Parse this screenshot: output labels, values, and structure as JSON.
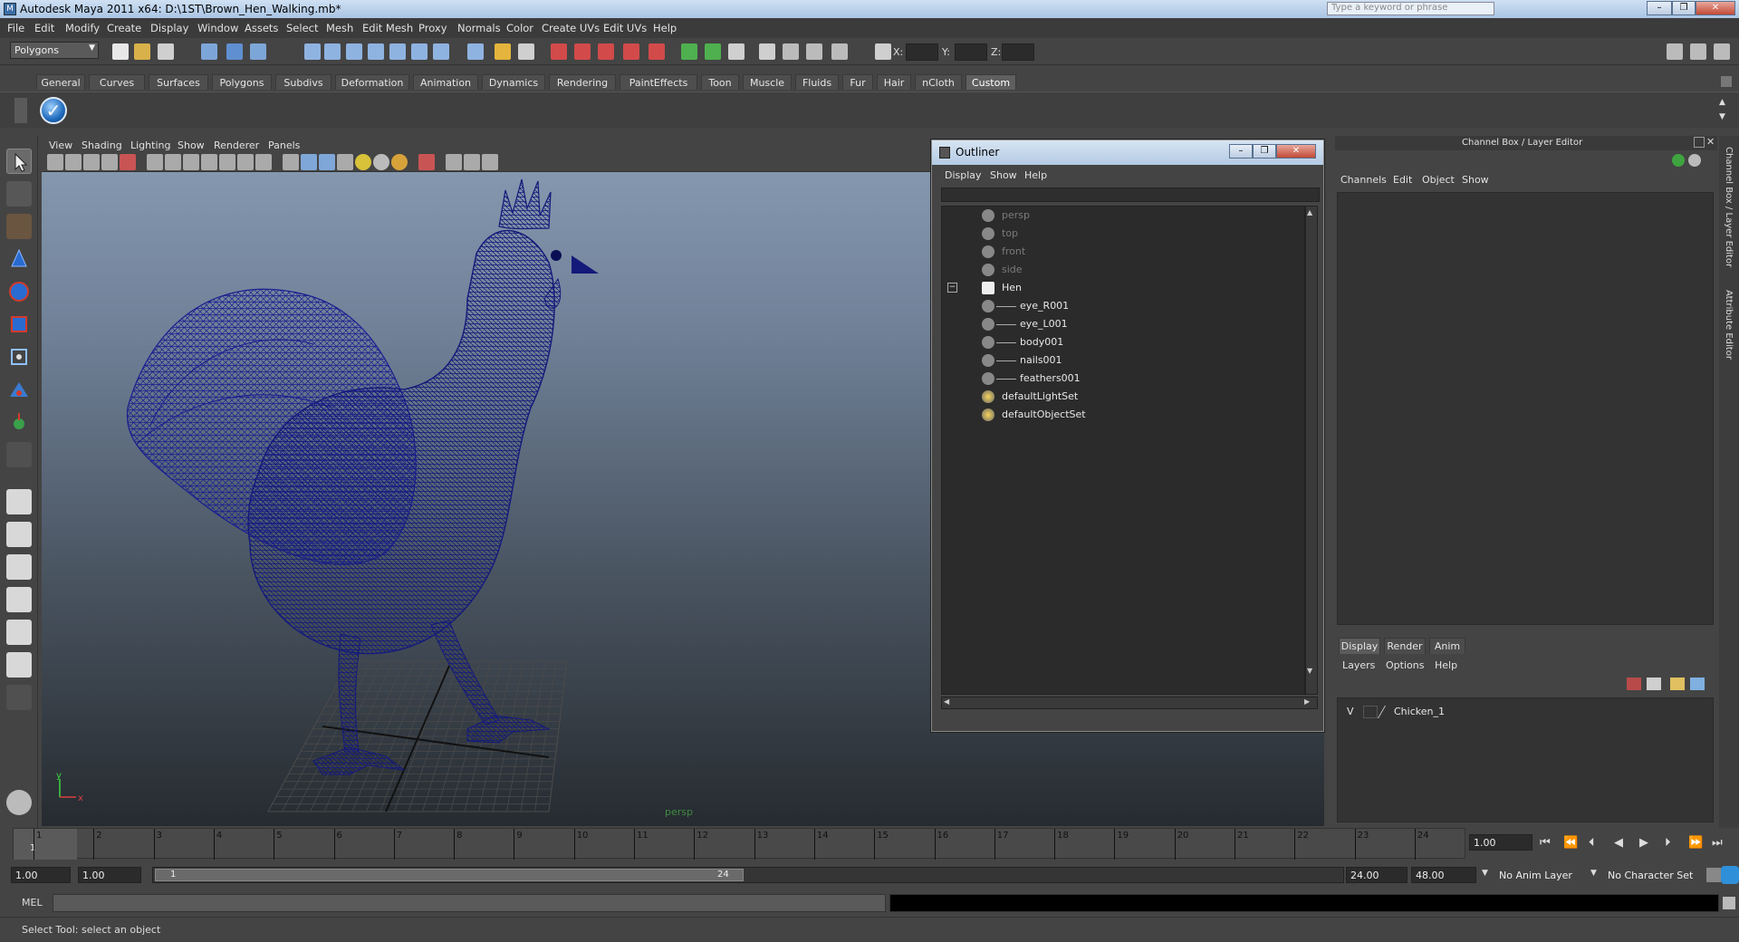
{
  "window": {
    "title": "Autodesk Maya 2011 x64: D:\\1ST\\Brown_Hen_Walking.mb*",
    "search_placeholder": "Type a keyword or phrase"
  },
  "menubar": [
    "File",
    "Edit",
    "Modify",
    "Create",
    "Display",
    "Window",
    "Assets",
    "Select",
    "Mesh",
    "Edit Mesh",
    "Proxy",
    "Normals",
    "Color",
    "Create UVs",
    "Edit UVs",
    "Help"
  ],
  "statusline": {
    "mode": "Polygons",
    "x_label": "X:",
    "y_label": "Y:",
    "z_label": "Z:"
  },
  "shelf": {
    "tabs": [
      "General",
      "Curves",
      "Surfaces",
      "Polygons",
      "Subdivs",
      "Deformation",
      "Animation",
      "Dynamics",
      "Rendering",
      "PaintEffects",
      "Toon",
      "Muscle",
      "Fluids",
      "Fur",
      "Hair",
      "nCloth",
      "Custom"
    ],
    "active_tab": "Custom"
  },
  "viewport": {
    "menu": [
      "View",
      "Shading",
      "Lighting",
      "Show",
      "Renderer",
      "Panels"
    ],
    "camera": "persp",
    "axis_x": "x",
    "axis_y": "y",
    "wire_color": "#141a7a"
  },
  "outliner": {
    "title": "Outliner",
    "menu": [
      "Display",
      "Show",
      "Help"
    ],
    "items": [
      {
        "label": "persp",
        "dim": true
      },
      {
        "label": "top",
        "dim": true
      },
      {
        "label": "front",
        "dim": true
      },
      {
        "label": "side",
        "dim": true
      },
      {
        "label": "Hen",
        "dim": false
      },
      {
        "label": "eye_R001",
        "dim": false
      },
      {
        "label": "eye_L001",
        "dim": false
      },
      {
        "label": "body001",
        "dim": false
      },
      {
        "label": "nails001",
        "dim": false
      },
      {
        "label": "feathers001",
        "dim": false
      },
      {
        "label": "defaultLightSet",
        "dim": false
      },
      {
        "label": "defaultObjectSet",
        "dim": false
      }
    ]
  },
  "channelbox": {
    "title": "Channel Box / Layer Editor",
    "menu": [
      "Channels",
      "Edit",
      "Object",
      "Show"
    ],
    "side_labels": [
      "Channel Box / Layer Editor",
      "Attribute Editor"
    ]
  },
  "layers": {
    "tabs": [
      "Display",
      "Render",
      "Anim"
    ],
    "active_tab": "Display",
    "menu": [
      "Layers",
      "Options",
      "Help"
    ],
    "rows": [
      {
        "visible": "V",
        "name": "Chicken_1"
      }
    ]
  },
  "timeline": {
    "ticks": [
      "1",
      "2",
      "3",
      "4",
      "5",
      "6",
      "7",
      "8",
      "9",
      "10",
      "11",
      "12",
      "13",
      "14",
      "15",
      "16",
      "17",
      "18",
      "19",
      "20",
      "21",
      "22",
      "23",
      "24"
    ],
    "current_frame_marker": "1",
    "current_time": "1.00"
  },
  "range": {
    "start_time": "1.00",
    "playback_start": "1.00",
    "slider_start": "1",
    "slider_end": "24",
    "playback_end": "24.00",
    "end_time": "48.00",
    "anim_layer": "No Anim Layer",
    "character_set": "No Character Set"
  },
  "cmdline": {
    "label": "MEL"
  },
  "helpline": {
    "text": "Select Tool: select an object"
  }
}
